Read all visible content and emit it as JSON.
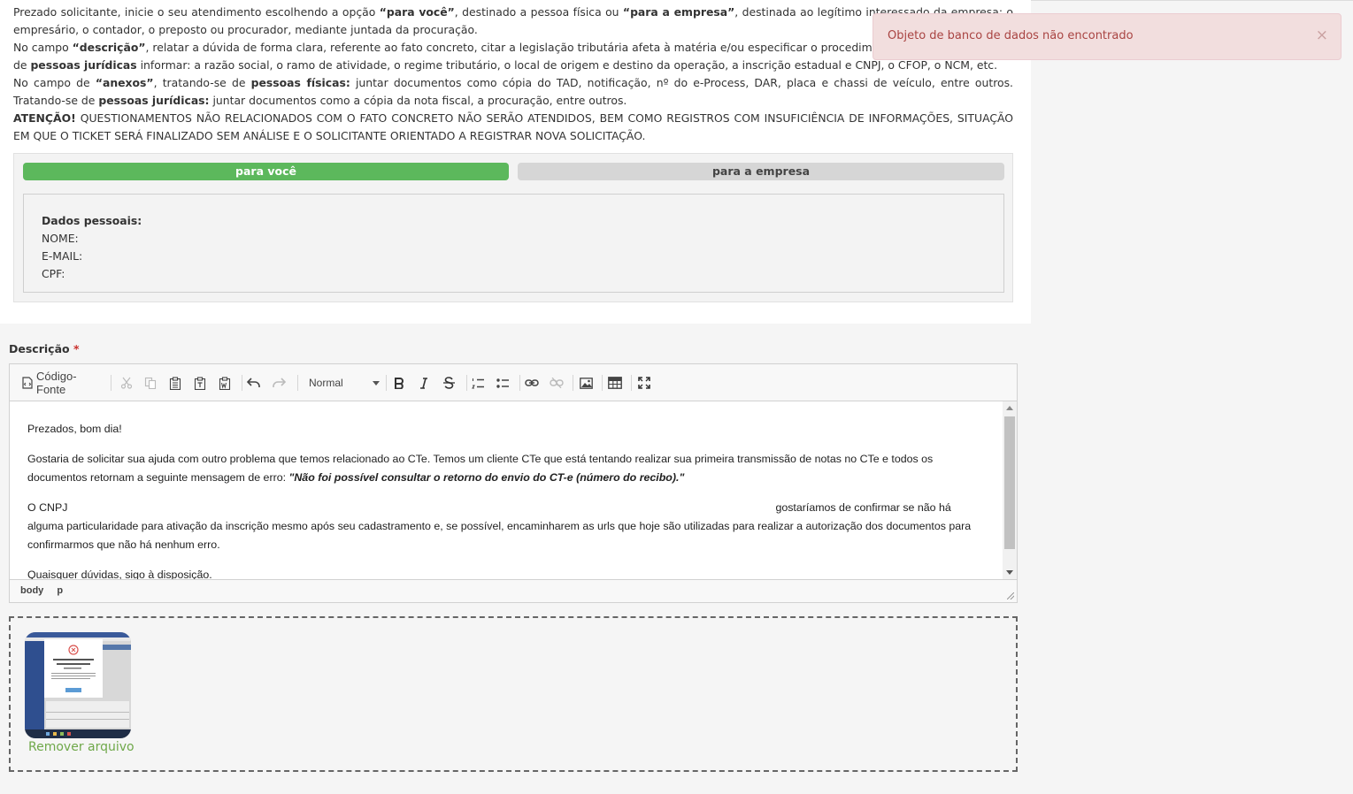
{
  "intro": {
    "p1_a": "Prezado solicitante, inicie o seu atendimento escolhendo a opção ",
    "p1_b": "“para você”",
    "p1_c": ", destinado a pessoa física ou ",
    "p1_d": "“para a empresa”",
    "p1_e": ", destinada ao legítimo interessado da empresa: o empresário, o contador, o preposto ou procurador, mediante juntada da procuração.",
    "p2_a": "No campo ",
    "p2_b": "“descrição”",
    "p2_c": ", relatar a dúvida de forma clara, referente ao fato concreto, citar a legislação tributária afeta à matéria e/ou especificar o procedimento ",
    "p2_d": "pessoas jurídicas",
    "p2_e": " informar: a razão social, o ramo de atividade, o regime tributário, o local de origem e destino da operação, a inscrição estadual e CNPJ, o CFOP, o NCM, etc.",
    "p2_gap": "                                                                                        ",
    "p2_de": "de ",
    "p3_a": "No campo de ",
    "p3_b": "“anexos”",
    "p3_c": ", tratando-se de ",
    "p3_d": "pessoas físicas:",
    "p3_e": " juntar documentos como cópia do TAD, notificação, nº do e-Process, DAR, placa e chassi de veículo, entre outros. Tratando-se de ",
    "p3_f": "pessoas jurídicas:",
    "p3_g": " juntar documentos como a cópia da nota fiscal, a procuração, entre outros.",
    "p4_a": "ATENÇÃO!",
    "p4_b": " QUESTIONAMENTOS NÃO RELACIONADOS COM O FATO CONCRETO NÃO SERÃO ATENDIDOS, BEM COMO REGISTROS COM INSUFICIÊNCIA DE INFORMAÇÕES, SITUAÇÃO EM QUE O TICKET SERÁ FINALIZADO SEM ANÁLISE E O SOLICITANTE ORIENTADO A REGISTRAR NOVA SOLICITAÇÃO."
  },
  "tabs": {
    "voce": "para você",
    "empresa": "para a empresa"
  },
  "personal": {
    "heading": "Dados pessoais:",
    "nome": "NOME:",
    "email": "E-MAIL:",
    "cpf": "CPF:"
  },
  "description": {
    "label": "Descrição",
    "required": "*"
  },
  "toolbar": {
    "source_label": "Código-Fonte",
    "format_value": "Normal"
  },
  "editor": {
    "line1": "Prezados, bom dia!",
    "line2_a": "Gostaria de solicitar sua ajuda com outro problema que temos relacionado ao CTe. Temos um cliente CTe que está tentando realizar sua primeira transmissão de notas no CTe e todos os documentos retornam a seguinte mensagem de erro: ",
    "line2_b": "\"Não foi possível consultar o retorno do envio do CT-e (número do recibo).\"",
    "line3_a": "O CNPJ",
    "line3_b": "gostaríamos de confirmar se não há alguma particularidade para ativação da inscrição mesmo após seu cadastramento e, se possível, encaminharem as urls que hoje são utilizadas para realizar a autorização dos documentos para confirmarmos que não há nenhum erro.",
    "line4": "Quaisquer dúvidas, sigo à disposição."
  },
  "statusbar": {
    "body": "body",
    "p": "p"
  },
  "attachments": {
    "remove_label": "Remover arquivo"
  },
  "alert": {
    "message": "Objeto de banco de dados não encontrado",
    "close": "×"
  },
  "colors": {
    "tab_active": "#5cb85c",
    "tab_inactive": "#d6d6d6",
    "alert_bg": "#f2dede",
    "alert_text": "#a94442",
    "remove_link": "#6fa84a"
  }
}
